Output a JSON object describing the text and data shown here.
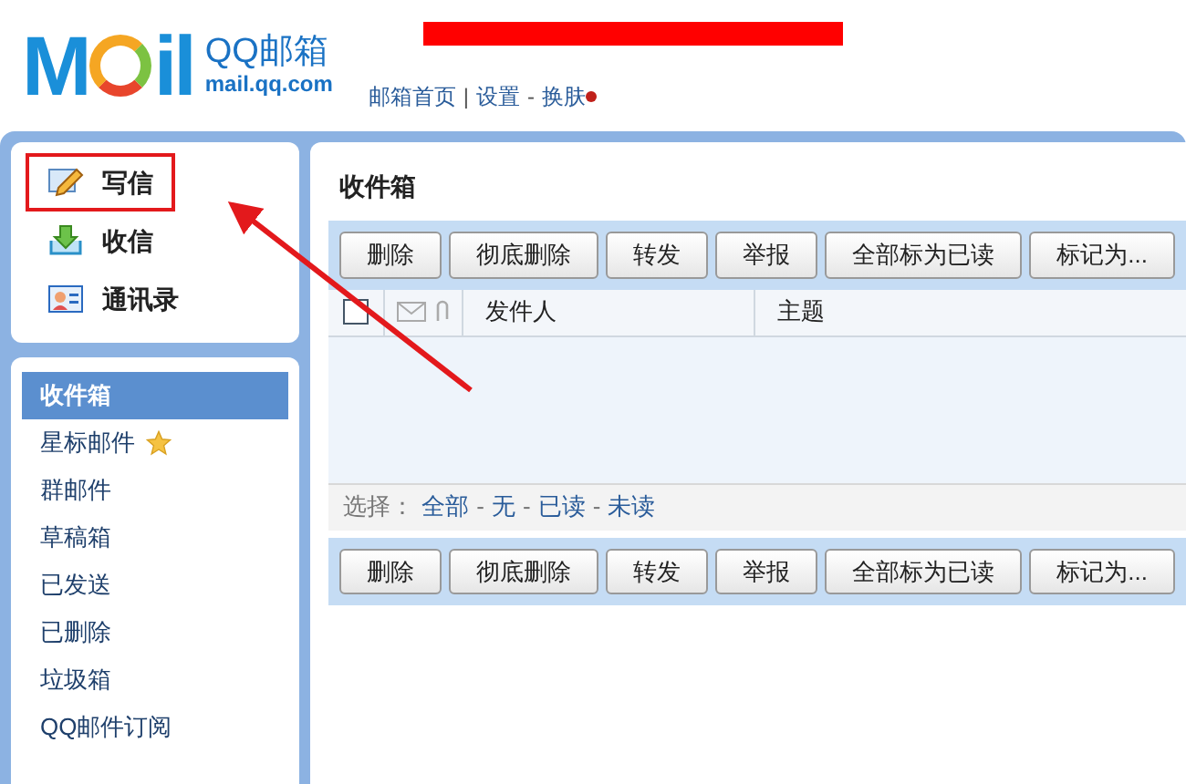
{
  "header": {
    "logo": {
      "left": "M",
      "right": "il",
      "name": "QQ邮箱",
      "domain": "mail.qq.com"
    },
    "nav": [
      {
        "kind": "link",
        "text": "邮箱首页",
        "dot": false
      },
      {
        "kind": "sep",
        "text": "|"
      },
      {
        "kind": "link",
        "text": "设置",
        "dot": false
      },
      {
        "kind": "sep",
        "text": "-"
      },
      {
        "kind": "link",
        "text": "换肤",
        "dot": true
      }
    ]
  },
  "quick_actions": [
    {
      "label": "写信",
      "kind": "compose",
      "highlighted": true
    },
    {
      "label": "收信",
      "kind": "receive",
      "highlighted": false
    },
    {
      "label": "通讯录",
      "kind": "contacts",
      "highlighted": false
    }
  ],
  "folders": [
    {
      "label": "收件箱",
      "selected": true,
      "star": false
    },
    {
      "label": "星标邮件",
      "selected": false,
      "star": true
    },
    {
      "label": "群邮件",
      "selected": false,
      "star": false
    },
    {
      "label": "草稿箱",
      "selected": false,
      "star": false
    },
    {
      "label": "已发送",
      "selected": false,
      "star": false
    },
    {
      "label": "已删除",
      "selected": false,
      "star": false
    },
    {
      "label": "垃圾箱",
      "selected": false,
      "star": false
    },
    {
      "label": "QQ邮件订阅",
      "selected": false,
      "star": false
    }
  ],
  "main": {
    "title": "收件箱",
    "toolbar_top": [
      "删除",
      "彻底删除",
      "转发",
      "举报",
      "全部标为已读",
      "标记为..."
    ],
    "columns": [
      {
        "kind": "checkbox",
        "checked": false
      },
      {
        "kind": "icons"
      },
      {
        "kind": "text",
        "text": "发件人"
      },
      {
        "kind": "text",
        "text": "主题"
      }
    ],
    "select_bar": {
      "label": "选择：",
      "options": [
        {
          "kind": "link",
          "text": "全部"
        },
        {
          "kind": "sep",
          "text": "-"
        },
        {
          "kind": "link",
          "text": "无"
        },
        {
          "kind": "sep",
          "text": "-"
        },
        {
          "kind": "link",
          "text": "已读"
        },
        {
          "kind": "sep",
          "text": "-"
        },
        {
          "kind": "link",
          "text": "未读"
        }
      ]
    },
    "toolbar_bottom": [
      "删除",
      "彻底删除",
      "转发",
      "举报",
      "全部标为已读",
      "标记为..."
    ]
  }
}
